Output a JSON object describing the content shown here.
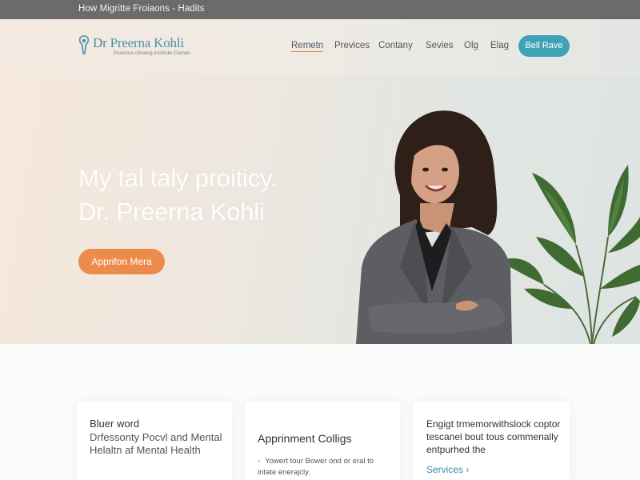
{
  "topbar": {
    "text": "How Migritte Froiaons - Hadits"
  },
  "header": {
    "logo_name": "Dr Preerna Kohli",
    "logo_tagline": "Psoricus clinalog institute Cernas",
    "nav": [
      "Remetn",
      "Previces",
      "Contany",
      "Sevies",
      "Olg",
      "Elag"
    ],
    "cta_label": "Bell Rave"
  },
  "hero": {
    "title_line1": "My tal taly proiticy.",
    "title_line2": "Dr. Preerna Kohli",
    "button_label": "Apprifon Mera"
  },
  "cards": {
    "c1": {
      "title": "Bluer word",
      "body": "Drfessonty Pocvl and Mental Helaltn af Mental Health"
    },
    "c2": {
      "title": "Apprinment Colligs",
      "bullet": "›",
      "body": "Yowert tour Bower ond or eral to intate enerajcly."
    },
    "c3": {
      "body": "Engigt trmemorwithslock coptor tescanel bout tous commenally entpurhed the",
      "link": "Services ›"
    }
  },
  "colors": {
    "accent_teal": "#3fa3b8",
    "accent_orange": "#ed8c4a",
    "topbar": "#6b6b6b"
  },
  "icons": {
    "logo": "tooth-icon"
  }
}
